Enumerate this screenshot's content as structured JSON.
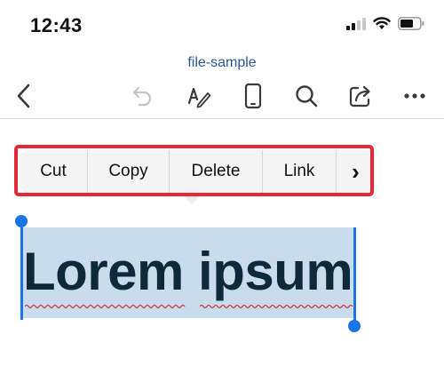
{
  "status_bar": {
    "time": "12:43",
    "icons": [
      "cellular-signal-icon",
      "wifi-icon",
      "battery-icon"
    ]
  },
  "document": {
    "title": "file-sample",
    "body_text": "Lorem ipsum"
  },
  "toolbar": {
    "icons": [
      "back-icon",
      "undo-icon",
      "draw-pen-icon",
      "mobile-view-icon",
      "search-icon",
      "share-icon",
      "more-icon"
    ]
  },
  "context_menu": {
    "items": [
      {
        "label": "Cut"
      },
      {
        "label": "Copy"
      },
      {
        "label": "Delete"
      },
      {
        "label": "Link"
      }
    ],
    "more_glyph": "›"
  },
  "colors": {
    "accent": "#2b579a",
    "selection": "#c9dcee",
    "selection_handle": "#1a73e8",
    "highlight_frame": "#e52a35",
    "spell_squiggle": "#d0343f"
  }
}
